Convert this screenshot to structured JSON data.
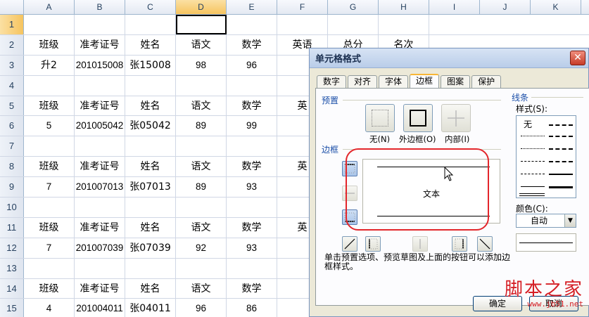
{
  "columns": [
    "A",
    "B",
    "C",
    "D",
    "E",
    "F",
    "G",
    "H",
    "I",
    "J",
    "K"
  ],
  "active_column": "D",
  "active_row": 1,
  "rows": [
    {
      "num": "1",
      "cells": [
        "",
        "",
        "",
        "",
        "",
        "",
        "",
        ""
      ]
    },
    {
      "num": "2",
      "cells": [
        "班级",
        "准考证号",
        "姓名",
        "语文",
        "数学",
        "英语",
        "总分",
        "名次"
      ]
    },
    {
      "num": "3",
      "cells": [
        "升2",
        "201015008",
        "张15008",
        "98",
        "96",
        "",
        "",
        ""
      ]
    },
    {
      "num": "4",
      "cells": [
        "",
        "",
        "",
        "",
        "",
        "",
        "",
        ""
      ]
    },
    {
      "num": "5",
      "cells": [
        "班级",
        "准考证号",
        "姓名",
        "语文",
        "数学",
        "英",
        "",
        ""
      ]
    },
    {
      "num": "6",
      "cells": [
        "5",
        "201005042",
        "张05042",
        "89",
        "99",
        "",
        "",
        ""
      ]
    },
    {
      "num": "7",
      "cells": [
        "",
        "",
        "",
        "",
        "",
        "",
        "",
        ""
      ]
    },
    {
      "num": "8",
      "cells": [
        "班级",
        "准考证号",
        "姓名",
        "语文",
        "数学",
        "英",
        "",
        ""
      ]
    },
    {
      "num": "9",
      "cells": [
        "7",
        "201007013",
        "张07013",
        "89",
        "93",
        "",
        "",
        ""
      ]
    },
    {
      "num": "10",
      "cells": [
        "",
        "",
        "",
        "",
        "",
        "",
        "",
        ""
      ]
    },
    {
      "num": "11",
      "cells": [
        "班级",
        "准考证号",
        "姓名",
        "语文",
        "数学",
        "英",
        "",
        ""
      ]
    },
    {
      "num": "12",
      "cells": [
        "7",
        "201007039",
        "张07039",
        "92",
        "93",
        "",
        "",
        ""
      ]
    },
    {
      "num": "13",
      "cells": [
        "",
        "",
        "",
        "",
        "",
        "",
        "",
        ""
      ]
    },
    {
      "num": "14",
      "cells": [
        "班级",
        "准考证号",
        "姓名",
        "语文",
        "数学",
        "",
        "",
        ""
      ]
    },
    {
      "num": "15",
      "cells": [
        "4",
        "201004011",
        "张04011",
        "96",
        "86",
        "",
        "",
        ""
      ]
    }
  ],
  "dialog": {
    "title": "单元格格式",
    "close_glyph": "✕",
    "tabs": [
      "数字",
      "对齐",
      "字体",
      "边框",
      "图案",
      "保护"
    ],
    "active_tab": "边框",
    "preset_label": "预置",
    "presets": [
      {
        "label": "无(N)"
      },
      {
        "label": "外边框(O)"
      },
      {
        "label": "内部(I)"
      }
    ],
    "border_label": "边框",
    "preview_text": "文本",
    "line_label": "线条",
    "style_label": "样式(S):",
    "style_none": "无",
    "color_label": "颜色(C):",
    "color_value": "自动",
    "hint": "单击预置选项、预览草图及上面的按钮可以添加边框样式。",
    "ok_label": "确定",
    "cancel_label": "取消",
    "annotation_color": "#e3262b"
  },
  "watermark": {
    "title": "脚本之家",
    "url": "www.jb51.net"
  }
}
